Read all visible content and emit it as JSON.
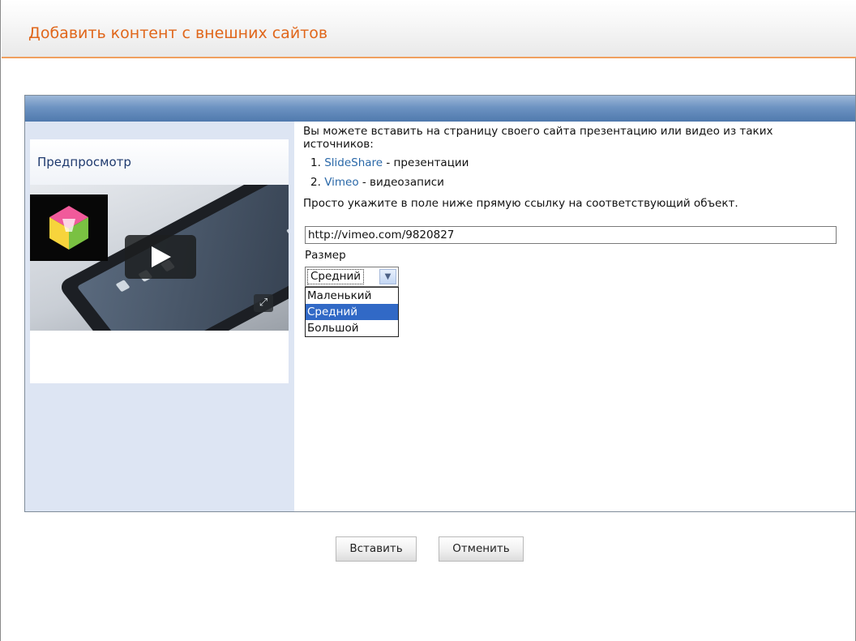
{
  "dialog": {
    "title": "Добавить контент с внешних сайтов"
  },
  "preview": {
    "title": "Предпросмотр"
  },
  "content": {
    "intro": "Вы можете вставить на страницу своего сайта презентацию или видео из таких источников:",
    "sources": [
      {
        "number": "1.",
        "link": "SlideShare",
        "desc": "- презентации"
      },
      {
        "number": "2.",
        "link": "Vimeo",
        "desc": "- видеозаписи"
      }
    ],
    "hint": "Просто укажите в поле ниже прямую ссылку на соответствующий объект.",
    "url_value": "http://vimeo.com/9820827",
    "size_label": "Размер",
    "size_selected": "Средний",
    "size_options": [
      "Маленький",
      "Средний",
      "Большой"
    ]
  },
  "buttons": {
    "insert": "Вставить",
    "cancel": "Отменить"
  },
  "colors": {
    "title": "#e0661a",
    "link": "#2a68a8",
    "header_bar": "#4f79ad",
    "sidebar": "#dde5f3",
    "selection": "#3169c6"
  },
  "icons": {
    "play": "play-icon",
    "fullscreen": "fullscreen-icon",
    "dropdown": "chevron-down-icon"
  }
}
